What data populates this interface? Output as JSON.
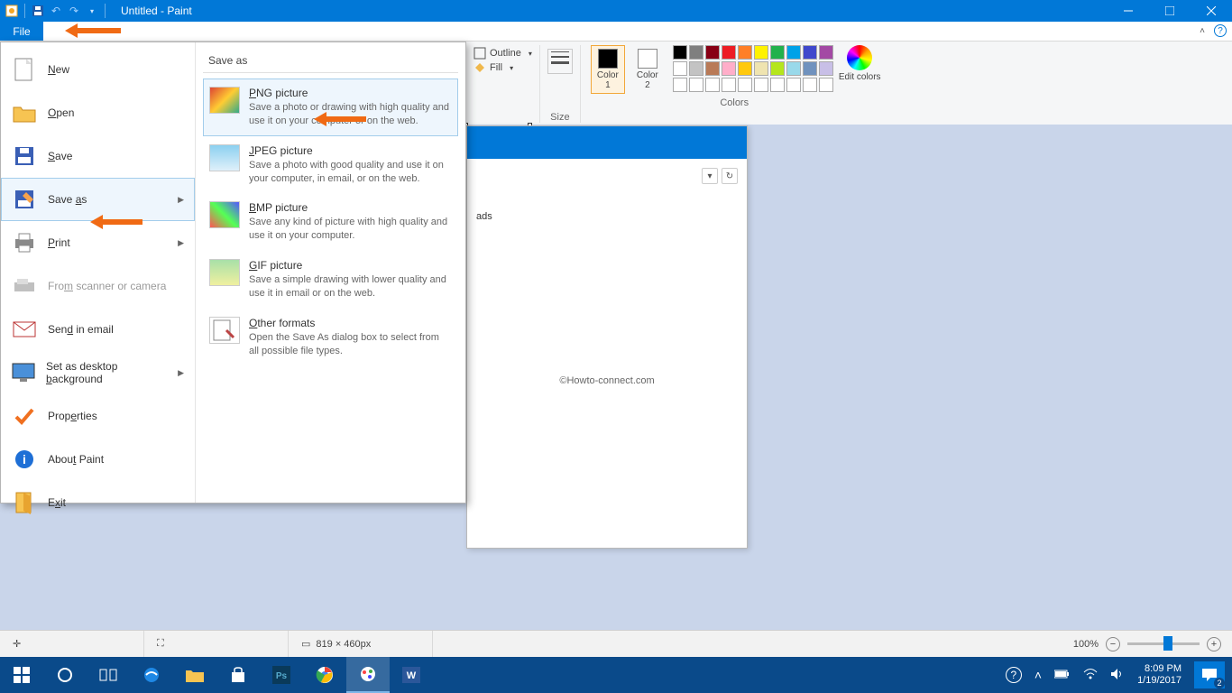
{
  "title": "Untitled - Paint",
  "file_tab": "File",
  "ribbon": {
    "outline": "Outline",
    "fill": "Fill",
    "size": "Size",
    "color1": "Color 1",
    "color2": "Color 2",
    "colors_label": "Colors",
    "edit_colors": "Edit colors",
    "palette_row1": [
      "#000000",
      "#7f7f7f",
      "#880015",
      "#ed1c24",
      "#ff7f27",
      "#fff200",
      "#22b14c",
      "#00a2e8",
      "#3f48cc",
      "#a349a4"
    ],
    "palette_row2": [
      "#ffffff",
      "#c3c3c3",
      "#b97a57",
      "#ffaec9",
      "#ffc90e",
      "#efe4b0",
      "#b5e61d",
      "#99d9ea",
      "#7092be",
      "#c8bfe7"
    ]
  },
  "file_menu": {
    "new": "New",
    "open": "Open",
    "save": "Save",
    "save_as": "Save as",
    "print": "Print",
    "scanner": "From scanner or camera",
    "send_email": "Send in email",
    "set_bg": "Set as desktop background",
    "properties": "Properties",
    "about": "About Paint",
    "exit": "Exit"
  },
  "save_as_panel": {
    "header": "Save as",
    "png": {
      "title": "PNG picture",
      "desc": "Save a photo or drawing with high quality and use it on your computer or on the web."
    },
    "jpeg": {
      "title": "JPEG picture",
      "desc": "Save a photo with good quality and use it on your computer, in email, or on the web."
    },
    "bmp": {
      "title": "BMP picture",
      "desc": "Save any kind of picture with high quality and use it on your computer."
    },
    "gif": {
      "title": "GIF picture",
      "desc": "Save a simple drawing with lower quality and use it in email or on the web."
    },
    "other": {
      "title": "Other formats",
      "desc": "Open the Save As dialog box to select from all possible file types."
    }
  },
  "docpanel": {
    "side_text": "ads",
    "dropdown_glyph": "▾",
    "refresh_glyph": "↻",
    "watermark": "©Howto-connect.com"
  },
  "status": {
    "dims": "819 × 460px",
    "zoom": "100%"
  },
  "tray": {
    "time": "8:09 PM",
    "date": "1/19/2017",
    "notif_count": "2"
  }
}
